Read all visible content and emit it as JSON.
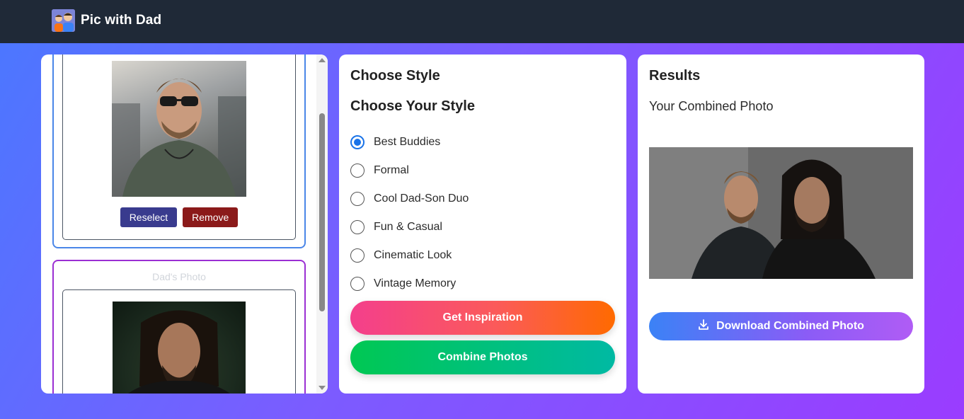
{
  "app": {
    "title": "Pic with Dad",
    "logo_icon": "dad-and-son-logo-icon"
  },
  "upload": {
    "son": {
      "reselect_label": "Reselect",
      "remove_label": "Remove"
    },
    "dad": {
      "label": "Dad's Photo"
    }
  },
  "style": {
    "panel_title": "Choose Style",
    "heading": "Choose Your Style",
    "selected": "Best Buddies",
    "options": [
      "Best Buddies",
      "Formal",
      "Cool Dad-Son Duo",
      "Fun & Casual",
      "Cinematic Look",
      "Vintage Memory"
    ],
    "inspiration_label": "Get Inspiration",
    "combine_label": "Combine Photos"
  },
  "results": {
    "title": "Results",
    "subtitle": "Your Combined Photo",
    "download_label": "Download Combined Photo",
    "download_icon": "download-icon"
  },
  "colors": {
    "topbar": "#1f2937",
    "accent_blue": "#1a73e8",
    "reselect": "#393b8e",
    "remove": "#8b1a1a"
  }
}
